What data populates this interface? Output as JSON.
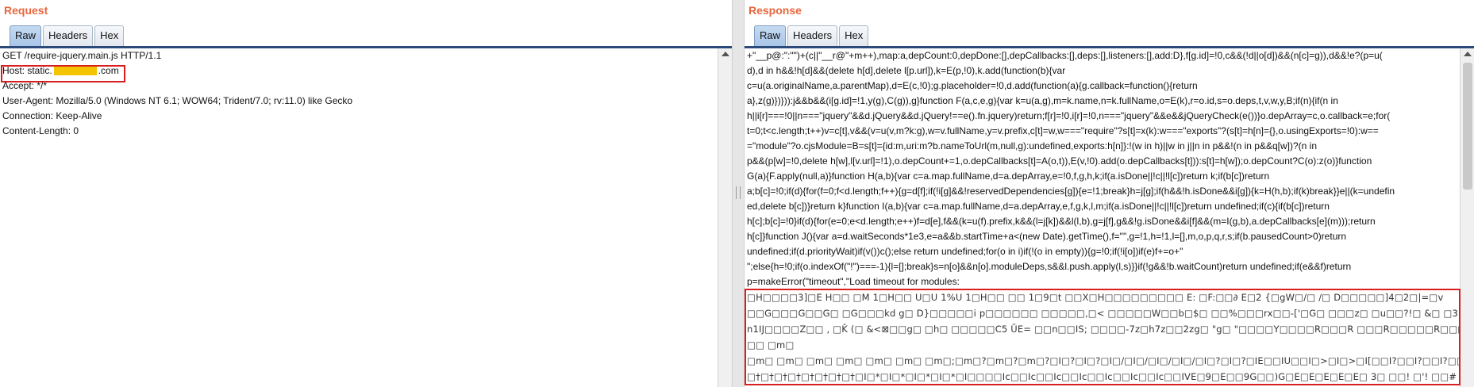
{
  "request": {
    "title": "Request",
    "tabs": [
      "Raw",
      "Headers",
      "Hex"
    ],
    "active_tab": "Raw",
    "lines": [
      "GET /require-jquery.main.js HTTP/1.1",
      "Accept: */*",
      "User-Agent: Mozilla/5.0 (Windows NT 6.1; WOW64; Trident/7.0; rv:11.0) like Gecko",
      "Connection: Keep-Alive",
      "Content-Length: 0"
    ],
    "host_prefix": "Host: static.",
    "host_suffix": ".com"
  },
  "response": {
    "title": "Response",
    "tabs": [
      "Raw",
      "Headers",
      "Hex"
    ],
    "active_tab": "Raw",
    "code_lines": [
      "+\"__p@:\":\"\")+(c||\"__r@\"+m++),map:a,depCount:0,depDone:[],depCallbacks:[],deps:[],listeners:[],add:D},f[g.id]=!0,c&&(!d||o[d])&&(n[c]=g)),d&&!e?(p=u(",
      "d),d in h&&!h[d]&&(delete h[d],delete l[p.url]),k=E(p,!0),k.add(function(b){var",
      "c=u(a.originalName,a.parentMap),d=E(c,!0);g.placeholder=!0,d.add(function(a){g.callback=function(){return",
      "a},z(g)})})):j&&b&&(i[g.id]=!1,y(g),C(g)),g}function F(a,c,e,g){var k=u(a,g),m=k.name,n=k.fullName,o=E(k),r=o.id,s=o.deps,t,v,w,y,B;if(n){if(n in",
      "h||i[r]===!0||n===\"jquery\"&&d.jQuery&&d.jQuery!==e().fn.jquery)return;f[r]=!0,i[r]=!0,n===\"jquery\"&&e&&jQueryCheck(e())}o.depArray=c,o.callback=e;for(",
      "t=0;t<c.length;t++)v=c[t],v&&(v=u(v,m?k:g),w=v.fullName,y=v.prefix,c[t]=w,w===\"require\"?s[t]=x(k):w===\"exports\"?(s[t]=h[n]={},o.usingExports=!0):w==",
      "=\"module\"?o.cjsModule=B=s[t]={id:m,uri:m?b.nameToUrl(m,null,g):undefined,exports:h[n]}:!(w in h)||w in j||n in p&&!(n in p&&q[w])?(n in",
      "p&&(p[w]=!0,delete h[w],l[v.url]=!1),o.depCount+=1,o.depCallbacks[t]=A(o,t)),E(v,!0).add(o.depCallbacks[t])):s[t]=h[w]);o.depCount?C(o):z(o)}function",
      "G(a){F.apply(null,a)}function H(a,b){var c=a.map.fullName,d=a.depArray,e=!0,f,g,h,k;if(a.isDone||!c||!l[c])return k;if(b[c])return",
      "a;b[c]=!0;if(d){for(f=0;f<d.length;f++){g=d[f];if(!i[g]&&!reservedDependencies[g]){e=!1;break}h=j[g];if(h&&!h.isDone&&i[g]){k=H(h,b);if(k)break}}e||(k=undefin",
      "ed,delete b[c])}return k}function I(a,b){var c=a.map.fullName,d=a.depArray,e,f,g,k,l,m;if(a.isDone||!c||!l[c])return undefined;if(c){if(b[c])return",
      "h[c];b[c]=!0}if(d){for(e=0;e<d.length;e++)f=d[e],f&&(k=u(f).prefix,k&&(l=j[k])&&l(l,b),g=j[f],g&&!g.isDone&&i[f]&&(m=I(g,b),a.depCallbacks[e](m)));return",
      "h[c]}function J(){var a=d.waitSeconds*1e3,e=a&&b.startTime+a<(new Date).getTime(),f=\"\",g=!1,h=!1,l=[],m,o,p,q,r,s;if(b.pausedCount>0)return",
      "undefined;if(d.priorityWait)if(v())c();else return undefined;for(o in i)if(!(o in empty)){g=!0;if(!i[o])if(e)f+=o+\"",
      "\";else{h=!0;if(o.indexOf(\"!\")===-1){l=[];break}s=n[o]&&n[o].moduleDeps,s&&l.push.apply(l,s)}}if(!g&&!b.waitCount)return undefined;if(e&&f)return",
      "p=makeError(\"timeout\",\"Load timeout for modules:"
    ],
    "garbled_lines": [
      "□H□□□□3]□E H□□ □M 1□H□□ U□U 1%U 1□H□□ □□ 1□9□t □□X□H□□□□□□□□□ E: □F:□□∂ E□2 {□gW□/□ /□ D□□□□□]4□2□|=□v",
      "□□G□□□G□□G□ □G□□□kd g□ D}□□□□□i p□□□□□□ □□□□□,□< □□□□□W□□b□$□ □□%□□□rx□□-['□G□ □□□z□ □u□□?!□ &□ □3□/□□",
      "n1IJ□□□□Z□□ , □Ǩ (□ &<⊠□□g□ □h□ □□□□□C5 ŪE= □□n□□IS; □□□□-7z□h7z□□2zg□ \"g□ \"□□□□Y□□□□R□□□R □□□R□□□□□R□□□ □□",
      "□□ □m□",
      "□m□ □m□ □m□ □m□ □m□ □m□ □m□;□m□?□m□?□m□?□I□?□I□?□I□/□I□/□I□/□I□/□I□?□I□?□IE□□IU□□I□>□I□>□I[□□I?□□I?□□I?□□I?",
      "□†□†□†□†□†□†□†□†□I□*□I□*□I□*□I□*□I□□□□Ic□□Ic□□Ic□□Ic□□Ic□□Ic□□Ic□□IVE□9□E□□9G□□)G□E□E□E□E□E□ 3□ □□! □'! □□#"
    ]
  }
}
